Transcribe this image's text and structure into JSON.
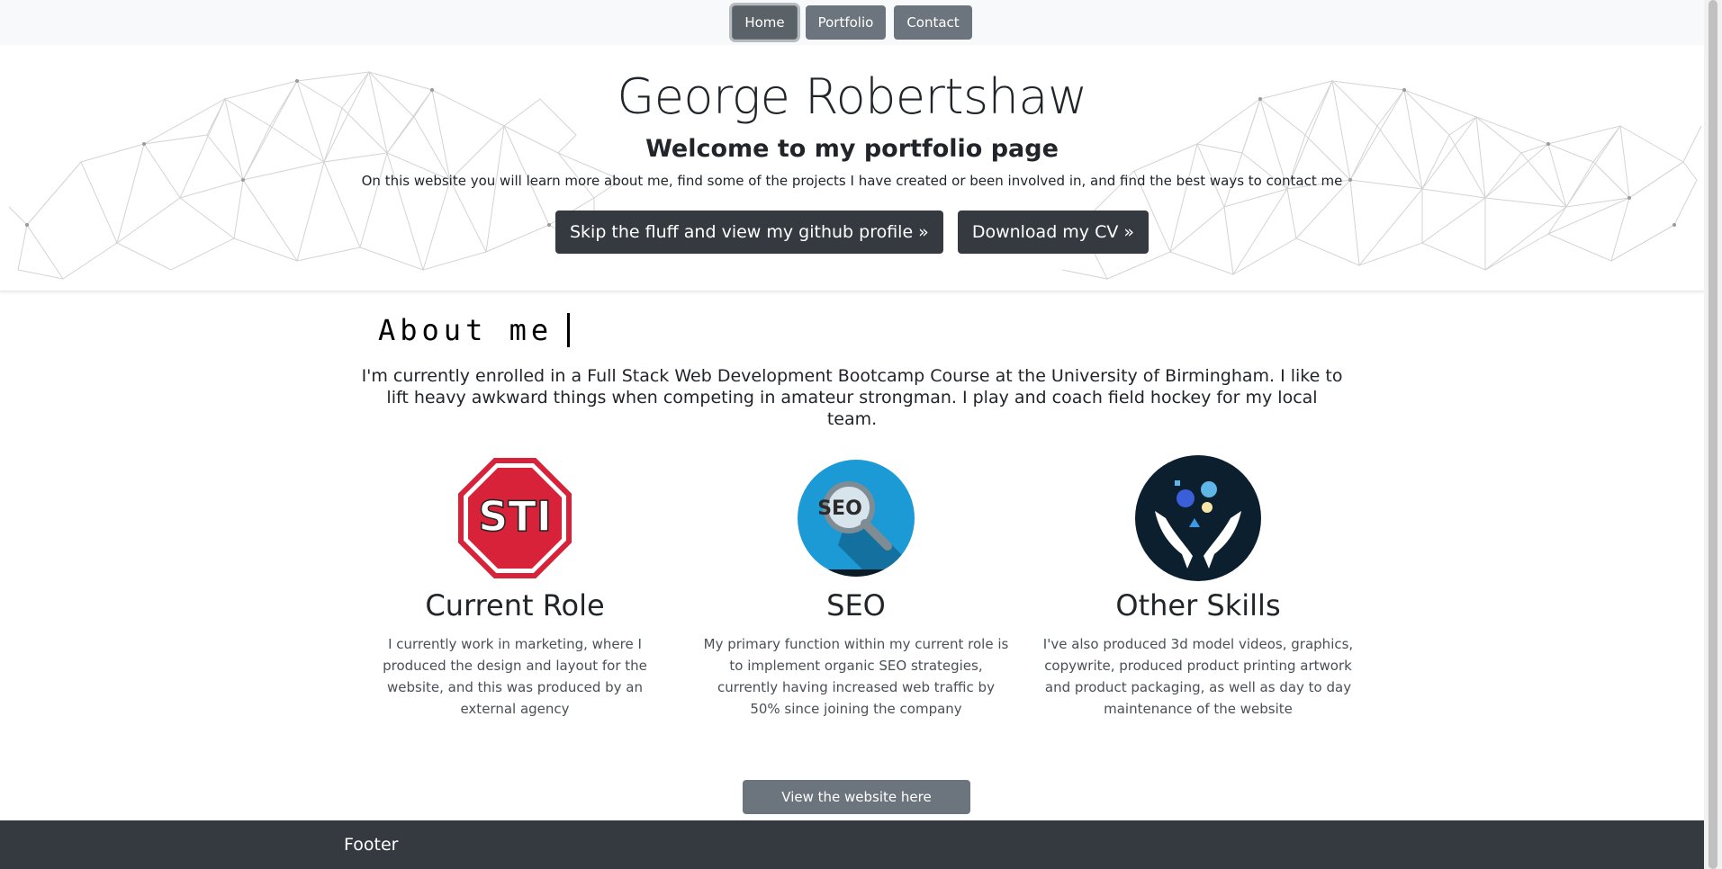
{
  "nav": {
    "items": [
      {
        "label": "Home"
      },
      {
        "label": "Portfolio"
      },
      {
        "label": "Contact"
      }
    ]
  },
  "hero": {
    "title": "George Robertshaw",
    "subtitle": "Welcome to my portfolio page",
    "lead": "On this website you will learn more about me, find some of the projects I have created or been involved in, and find the best ways to contact me",
    "github_button": "Skip the fluff and view my github profile »",
    "cv_button": "Download my CV »"
  },
  "about": {
    "heading": "About me",
    "text": "I'm currently enrolled in a Full Stack Web Development Bootcamp Course at the University of Birmingham. I like to lift heavy awkward things when competing in amateur strongman. I play and coach field hockey for my local team."
  },
  "skills": [
    {
      "icon_text": "STI",
      "title": "Current Role",
      "description": "I currently work in marketing, where I produced the design and layout for the website, and this was produced by an external agency"
    },
    {
      "icon_text": "SEO",
      "title": "SEO",
      "description": "My primary function within my current role is to implement organic SEO strategies, currently having increased web traffic by 50% since joining the company"
    },
    {
      "title": "Other Skills",
      "description": "I've also produced 3d model videos, graphics, copywrite, produced product printing artwork and product packaging, as well as day to day maintenance of the website"
    }
  ],
  "view_button": "View the website here",
  "footer": {
    "text": "Footer"
  },
  "colors": {
    "nav_bg": "#f8f9fa",
    "secondary": "#6c757d",
    "dark": "#343a40",
    "sti_red": "#d7223a",
    "seo_blue": "#1c9ad6",
    "skills_navy": "#0b1f2e"
  }
}
